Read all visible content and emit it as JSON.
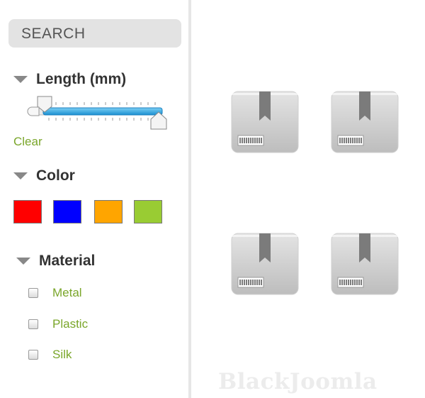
{
  "search": {
    "label": "SEARCH"
  },
  "filters": {
    "length": {
      "title": "Length (mm)",
      "clear_label": "Clear",
      "range_min_fraction": 0.1,
      "range_max_fraction": 1.0
    },
    "color": {
      "title": "Color",
      "swatches": [
        {
          "name": "red",
          "hex": "#ff0000"
        },
        {
          "name": "blue",
          "hex": "#0000ff"
        },
        {
          "name": "orange",
          "hex": "#ffa500"
        },
        {
          "name": "green",
          "hex": "#99cc33"
        }
      ]
    },
    "material": {
      "title": "Material",
      "options": [
        {
          "label": "Metal",
          "checked": false
        },
        {
          "label": "Plastic",
          "checked": false
        },
        {
          "label": "Silk",
          "checked": false
        }
      ]
    }
  },
  "products": [
    {
      "icon": "package-box-icon"
    },
    {
      "icon": "package-box-icon"
    },
    {
      "icon": "package-box-icon"
    },
    {
      "icon": "package-box-icon"
    }
  ],
  "watermark": "BlackJoomla",
  "colors": {
    "accent": "#7aa62a",
    "slider": "#2aa5e0",
    "panel": "#e3e3e3"
  }
}
